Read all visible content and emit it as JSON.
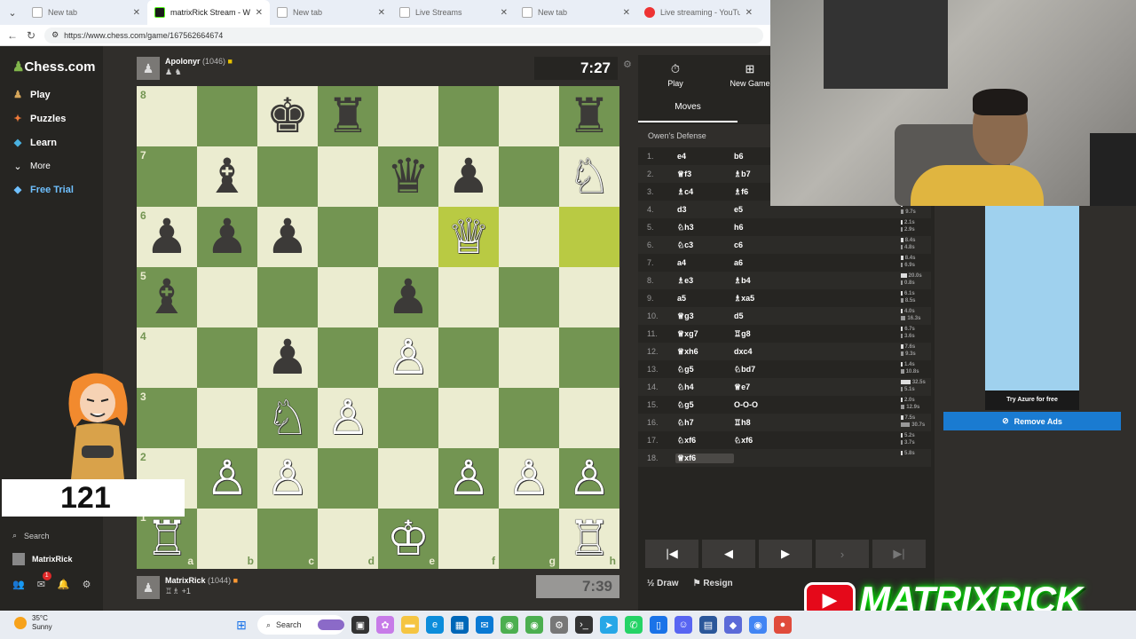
{
  "browser": {
    "tabs": [
      {
        "title": "New tab",
        "favicon": "page-icon",
        "active": false
      },
      {
        "title": "matrixRick Stream - Wa",
        "favicon": "kick-icon",
        "active": true
      },
      {
        "title": "New tab",
        "favicon": "page-icon",
        "active": false
      },
      {
        "title": "Live Streams",
        "favicon": "page-icon",
        "active": false
      },
      {
        "title": "New tab",
        "favicon": "page-icon",
        "active": false
      },
      {
        "title": "Live streaming - YouTube St",
        "favicon": "youtube-icon",
        "active": false
      }
    ],
    "url": "https://www.chess.com/game/167562664674"
  },
  "sidebar": {
    "logo": "Chess.com",
    "items": [
      {
        "label": "Play",
        "icon": "play-icon"
      },
      {
        "label": "Puzzles",
        "icon": "puzzle-icon"
      },
      {
        "label": "Learn",
        "icon": "learn-icon"
      },
      {
        "label": "More",
        "icon": "chevron-down-icon"
      },
      {
        "label": "Free Trial",
        "icon": "diamond-icon"
      }
    ],
    "search_label": "Search",
    "user": "MatrixRick",
    "notification_count": "1"
  },
  "top_player": {
    "name": "Apolonyr",
    "rating": "(1046)",
    "clock": "7:27"
  },
  "bottom_player": {
    "name": "MatrixRick",
    "rating": "(1044)",
    "captured_extra": "+1",
    "clock": "7:39"
  },
  "board": {
    "colors": {
      "light": "#ebecd0",
      "dark": "#739552",
      "highlight": "#b9ca43"
    },
    "files": [
      "a",
      "b",
      "c",
      "d",
      "e",
      "f",
      "g",
      "h"
    ],
    "ranks": [
      "8",
      "7",
      "6",
      "5",
      "4",
      "3",
      "2",
      "1"
    ],
    "highlight_squares": [
      "f6",
      "h6"
    ],
    "pieces": [
      {
        "sq": "c8",
        "piece": "♚",
        "color": "b"
      },
      {
        "sq": "d8",
        "piece": "♜",
        "color": "b"
      },
      {
        "sq": "h8",
        "piece": "♜",
        "color": "b"
      },
      {
        "sq": "b7",
        "piece": "♝",
        "color": "b"
      },
      {
        "sq": "e7",
        "piece": "♛",
        "color": "b"
      },
      {
        "sq": "f7",
        "piece": "♟",
        "color": "b"
      },
      {
        "sq": "h7",
        "piece": "♘",
        "color": "w"
      },
      {
        "sq": "a6",
        "piece": "♟",
        "color": "b"
      },
      {
        "sq": "b6",
        "piece": "♟",
        "color": "b"
      },
      {
        "sq": "c6",
        "piece": "♟",
        "color": "b"
      },
      {
        "sq": "f6",
        "piece": "♕",
        "color": "w"
      },
      {
        "sq": "a5",
        "piece": "♝",
        "color": "b"
      },
      {
        "sq": "e5",
        "piece": "♟",
        "color": "b"
      },
      {
        "sq": "c4",
        "piece": "♟",
        "color": "b"
      },
      {
        "sq": "e4",
        "piece": "♙",
        "color": "w"
      },
      {
        "sq": "c3",
        "piece": "♘",
        "color": "w"
      },
      {
        "sq": "d3",
        "piece": "♙",
        "color": "w"
      },
      {
        "sq": "b2",
        "piece": "♙",
        "color": "w"
      },
      {
        "sq": "c2",
        "piece": "♙",
        "color": "w"
      },
      {
        "sq": "f2",
        "piece": "♙",
        "color": "w"
      },
      {
        "sq": "g2",
        "piece": "♙",
        "color": "w"
      },
      {
        "sq": "h2",
        "piece": "♙",
        "color": "w"
      },
      {
        "sq": "a1",
        "piece": "♖",
        "color": "w"
      },
      {
        "sq": "e1",
        "piece": "♔",
        "color": "w"
      },
      {
        "sq": "h1",
        "piece": "♖",
        "color": "w"
      }
    ]
  },
  "panel": {
    "play_tab": "Play",
    "new_game_tab": "New Game",
    "moves_tab": "Moves",
    "opening": "Owen's Defense",
    "moves": [
      {
        "n": "1.",
        "w": "e4",
        "b": "b6",
        "wt": "",
        "bt": ""
      },
      {
        "n": "2.",
        "w": "♕f3",
        "b": "♗b7",
        "wt": "",
        "bt": ""
      },
      {
        "n": "3.",
        "w": "♗c4",
        "b": "♗f6",
        "wt": "",
        "bt": ""
      },
      {
        "n": "4.",
        "w": "d3",
        "b": "e5",
        "wt": "4.5s",
        "bt": "9.7s"
      },
      {
        "n": "5.",
        "w": "♘h3",
        "b": "h6",
        "wt": "2.1s",
        "bt": "2.9s"
      },
      {
        "n": "6.",
        "w": "♘c3",
        "b": "c6",
        "wt": "8.4s",
        "bt": "4.8s"
      },
      {
        "n": "7.",
        "w": "a4",
        "b": "a6",
        "wt": "8.4s",
        "bt": "6.9s"
      },
      {
        "n": "8.",
        "w": "♗e3",
        "b": "♗b4",
        "wt": "20.0s",
        "bt": "0.8s"
      },
      {
        "n": "9.",
        "w": "a5",
        "b": "♗xa5",
        "wt": "6.1s",
        "bt": "8.5s"
      },
      {
        "n": "10.",
        "w": "♕g3",
        "b": "d5",
        "wt": "4.0s",
        "bt": "16.3s"
      },
      {
        "n": "11.",
        "w": "♕xg7",
        "b": "♖g8",
        "wt": "6.7s",
        "bt": "3.6s"
      },
      {
        "n": "12.",
        "w": "♕xh6",
        "b": "dxc4",
        "wt": "7.6s",
        "bt": "9.3s"
      },
      {
        "n": "13.",
        "w": "♘g5",
        "b": "♘bd7",
        "wt": "1.4s",
        "bt": "10.8s"
      },
      {
        "n": "14.",
        "w": "♘h4",
        "b": "♕e7",
        "wt": "32.5s",
        "bt": "5.1s"
      },
      {
        "n": "15.",
        "w": "♘g5",
        "b": "O-O-O",
        "wt": "2.0s",
        "bt": "12.9s"
      },
      {
        "n": "16.",
        "w": "♘h7",
        "b": "♖h8",
        "wt": "7.5s",
        "bt": "30.7s"
      },
      {
        "n": "17.",
        "w": "♘xf6",
        "b": "♘xf6",
        "wt": "5.2s",
        "bt": "3.7s"
      },
      {
        "n": "18.",
        "w": "♕xf6",
        "b": "",
        "wt": "5.8s",
        "bt": ""
      }
    ],
    "draw_label": "Draw",
    "resign_label": "Resign"
  },
  "overlay": {
    "counter": "121",
    "brand": "MATRIXRICK",
    "ad_label": "Try Azure for free",
    "remove_ads": "Remove Ads"
  },
  "taskbar": {
    "temp": "35°C",
    "weather": "Sunny",
    "search": "Search"
  }
}
